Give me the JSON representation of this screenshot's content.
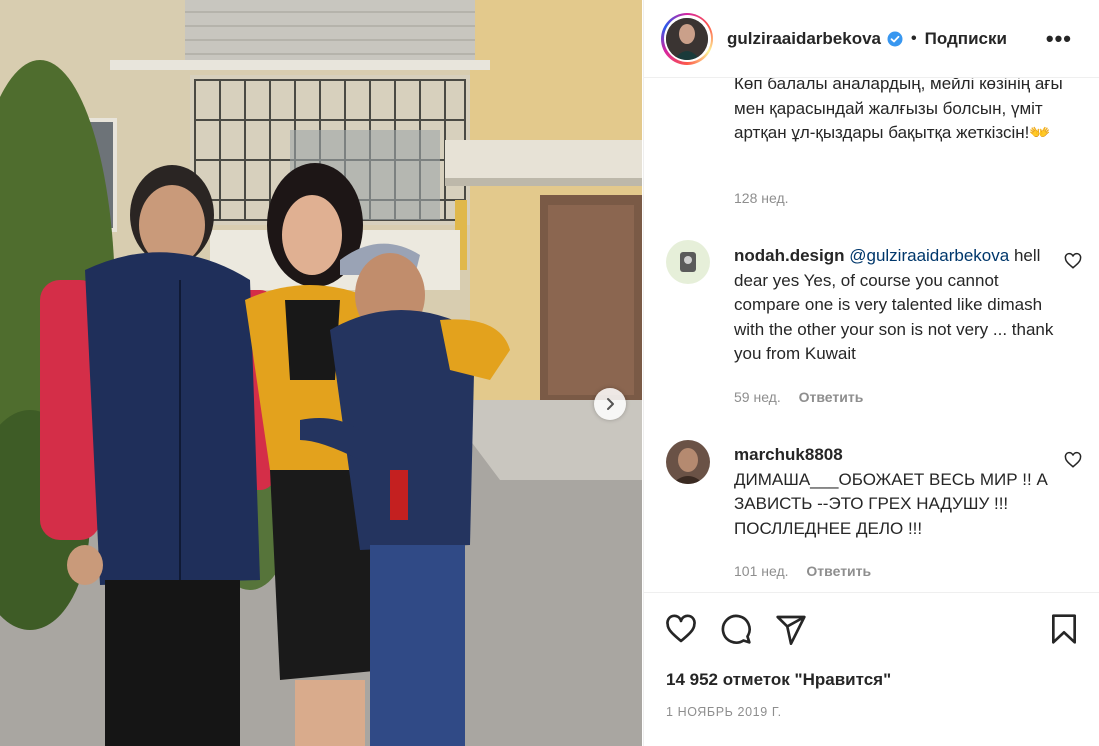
{
  "post": {
    "photo_alt": "Three people standing in front of a residential building",
    "next_button_icon": "chevron-right-icon"
  },
  "header": {
    "username": "gulziraaidarbekova",
    "verified_icon": "verified-badge-icon",
    "separator": "•",
    "follow_status": "Подписки",
    "more_icon": "more-options-icon"
  },
  "caption": {
    "text": "Көп балалы аналардың, мейлі көзінің ағы мен қарасындай жалғызы болсын, үміт артқан ұл-қыздары бақытқа жеткізсін!👐",
    "time": "128 нед."
  },
  "comments": [
    {
      "username": "nodah.design",
      "mention": "@gulziraaidarbekova",
      "text": "hell dear yes Yes, of course you cannot compare one is very talented like dimash with the other your son is not very ... thank you from Kuwait",
      "time": "59 нед.",
      "reply": "Ответить"
    },
    {
      "username": "marchuk8808",
      "mention": "",
      "text": "ДИМАША___ОБОЖАЕТ ВЕСЬ МИР !! А ЗАВИСТЬ --ЭТО ГРЕХ НАДУШУ !!! ПОСЛЛЕДНЕЕ ДЕЛО !!!",
      "time": "101 нед.",
      "reply": "Ответить"
    }
  ],
  "actions": {
    "like_icon": "heart-icon",
    "comment_icon": "comment-icon",
    "share_icon": "share-icon",
    "save_icon": "bookmark-icon"
  },
  "likes": "14 952 отметок \"Нравится\"",
  "date": "1 НОЯБРЬ 2019 Г."
}
